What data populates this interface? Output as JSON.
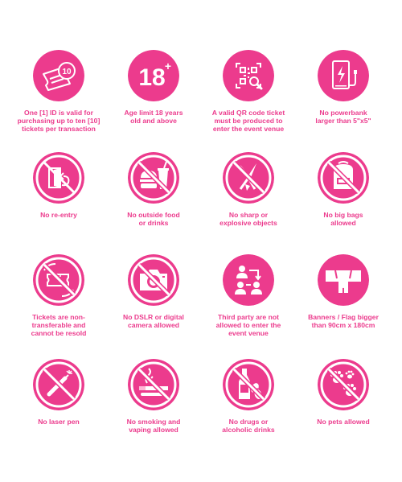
{
  "theme": {
    "accent": "#ec3b8d",
    "icon_fg": "#ffffff"
  },
  "rules": [
    {
      "icon": "ticket-10-icon",
      "caption": "One [1] ID is valid for\npurchasing up to ten [10]\ntickets per transaction"
    },
    {
      "icon": "age-18-plus-icon",
      "badge": "18",
      "badge_sup": "+",
      "caption": "Age limit 18 years\nold and above"
    },
    {
      "icon": "qr-code-scan-icon",
      "caption": "A valid QR code ticket\nmust be produced to\nenter the event venue"
    },
    {
      "icon": "powerbank-icon",
      "caption": "No powerbank\nlarger than 5\"x5\""
    },
    {
      "icon": "no-reentry-icon",
      "caption": "No re-entry"
    },
    {
      "icon": "no-food-drinks-icon",
      "caption": "No outside food\nor drinks"
    },
    {
      "icon": "no-sharp-objects-icon",
      "caption": "No sharp or\nexplosive objects"
    },
    {
      "icon": "no-big-bags-icon",
      "caption": "No big bags\nallowed"
    },
    {
      "icon": "non-transferable-ticket-icon",
      "caption": "Tickets are non-\ntransferable and\ncannot be resold"
    },
    {
      "icon": "no-dslr-camera-icon",
      "caption": "No DSLR or digital\ncamera allowed"
    },
    {
      "icon": "no-third-party-icon",
      "caption": "Third party are not\nallowed to enter the\nevent venue"
    },
    {
      "icon": "banner-flag-size-icon",
      "caption": "Banners / Flag bigger\nthan 90cm x 180cm"
    },
    {
      "icon": "no-laser-pen-icon",
      "caption": "No laser pen"
    },
    {
      "icon": "no-smoking-vaping-icon",
      "caption": "No smoking and\nvaping allowed"
    },
    {
      "icon": "no-drugs-alcohol-icon",
      "caption": "No drugs or\nalcoholic drinks"
    },
    {
      "icon": "no-pets-icon",
      "caption": "No pets allowed"
    }
  ]
}
